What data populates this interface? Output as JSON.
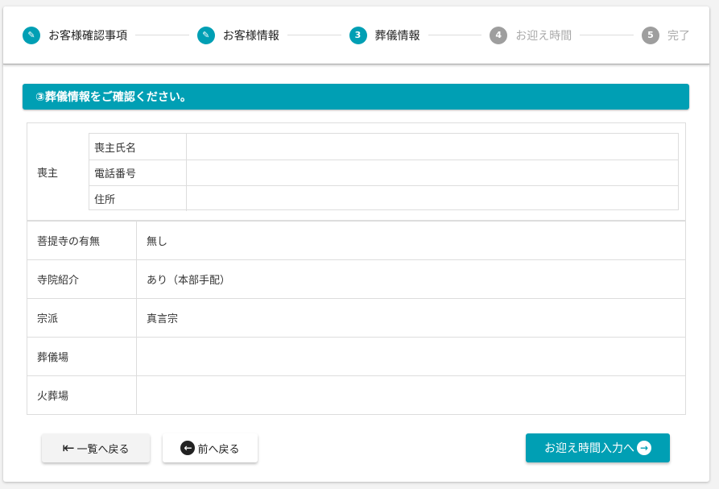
{
  "stepper": {
    "steps": [
      {
        "label": "お客様確認事項",
        "state": "done",
        "icon": "pencil-icon"
      },
      {
        "label": "お客様情報",
        "state": "done",
        "icon": "pencil-icon"
      },
      {
        "label": "葬儀情報",
        "state": "active",
        "num": "3"
      },
      {
        "label": "お迎え時間",
        "state": "todo",
        "num": "4"
      },
      {
        "label": "完了",
        "state": "todo",
        "num": "5"
      }
    ]
  },
  "banner": "③葬儀情報をご確認ください。",
  "mourner": {
    "label": "喪主",
    "fields": [
      {
        "label": "喪主氏名",
        "value": ""
      },
      {
        "label": "電話番号",
        "value": ""
      },
      {
        "label": "住所",
        "value": ""
      }
    ]
  },
  "rows": [
    {
      "label": "菩提寺の有無",
      "value": "無し"
    },
    {
      "label": "寺院紹介",
      "value": "あり（本部手配）"
    },
    {
      "label": "宗派",
      "value": "真言宗"
    },
    {
      "label": "葬儀場",
      "value": ""
    },
    {
      "label": "火葬場",
      "value": ""
    }
  ],
  "buttons": {
    "list": "一覧へ戻る",
    "prev": "前へ戻る",
    "next": "お迎え時間入力へ"
  },
  "colors": {
    "accent": "#009fb4",
    "inactive": "#9e9e9e"
  }
}
